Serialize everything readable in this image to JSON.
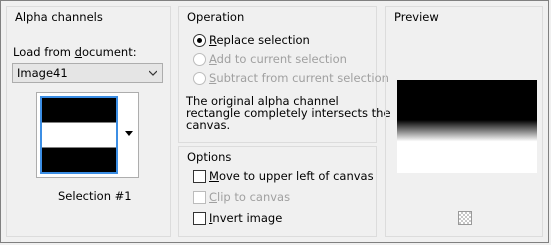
{
  "alpha": {
    "title": "Alpha channels",
    "load_label_pre": "Load from ",
    "load_label_u": "d",
    "load_label_post": "ocument:",
    "document_value": "Image41",
    "selection_caption": "Selection #1"
  },
  "operation": {
    "title": "Operation",
    "options": [
      {
        "u": "R",
        "rest": "eplace selection",
        "checked": true,
        "enabled": true
      },
      {
        "u": "A",
        "rest": "dd to current selection",
        "checked": false,
        "enabled": false
      },
      {
        "u": "S",
        "rest": "ubtract from current selection",
        "checked": false,
        "enabled": false
      }
    ],
    "info_line1": "The original alpha channel",
    "info_line2": "rectangle completely intersects the",
    "info_line3": "canvas."
  },
  "options": {
    "title": "Options",
    "items": [
      {
        "u": "M",
        "rest": "ove to upper left of canvas",
        "checked": false,
        "enabled": true
      },
      {
        "u": "C",
        "rest": "lip to canvas",
        "checked": false,
        "enabled": false
      },
      {
        "u": "I",
        "rest": "nvert image",
        "checked": false,
        "enabled": true
      }
    ]
  },
  "preview": {
    "title": "Preview"
  },
  "icons": {
    "chevron": "chevron-down-icon",
    "dropdown_arrow": "dropdown-arrow-icon",
    "zoom_grid": "zoom-grid-icon"
  },
  "colors": {
    "selection_border": "#3c8ee4",
    "background": "#f0f0f0"
  }
}
